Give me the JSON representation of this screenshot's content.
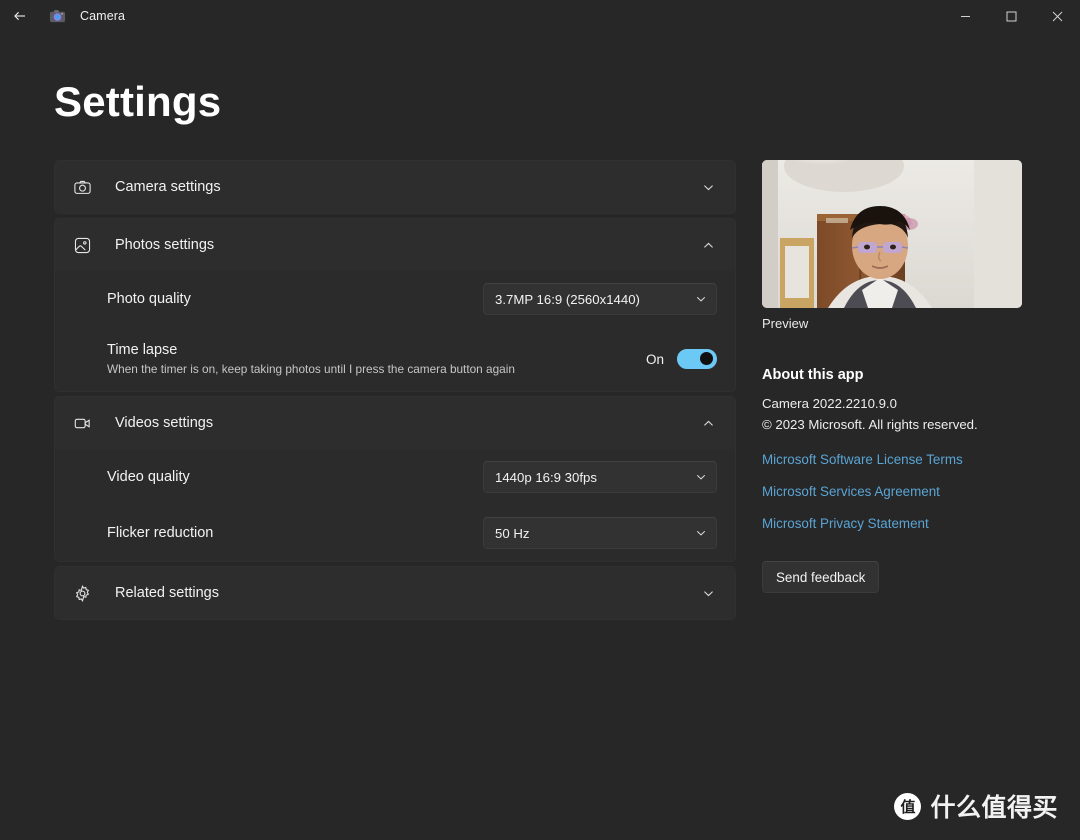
{
  "titlebar": {
    "back_label": "Back",
    "back_icon": "arrow-left-icon",
    "app_icon": "camera-app-icon",
    "app_title": "Camera",
    "minimize_label": "‒",
    "maximize_label": "☐",
    "close_label": "✕"
  },
  "page": {
    "title": "Settings"
  },
  "sections": [
    {
      "key": "camera",
      "icon": "camera-icon",
      "label": "Camera settings",
      "expanded": false,
      "chevron": "chevron-down-icon"
    },
    {
      "key": "photos",
      "icon": "photo-icon",
      "label": "Photos settings",
      "expanded": true,
      "chevron": "chevron-up-icon",
      "rows": [
        {
          "type": "combo",
          "label": "Photo quality",
          "value": "3.7MP 16:9 (2560x1440)"
        },
        {
          "type": "toggle",
          "label": "Time lapse",
          "description": "When the timer is on, keep taking photos until I press the camera button again",
          "state_label": "On",
          "checked": true
        }
      ]
    },
    {
      "key": "videos",
      "icon": "video-camera-icon",
      "label": "Videos settings",
      "expanded": true,
      "chevron": "chevron-up-icon",
      "rows": [
        {
          "type": "combo",
          "label": "Video quality",
          "value": "1440p 16:9 30fps"
        },
        {
          "type": "combo",
          "label": "Flicker reduction",
          "value": "50 Hz"
        }
      ]
    },
    {
      "key": "related",
      "icon": "gear-icon",
      "label": "Related settings",
      "expanded": false,
      "chevron": "chevron-down-icon"
    }
  ],
  "about": {
    "preview_caption": "Preview",
    "heading": "About this app",
    "app_name_version": "Camera  2022.2210.9.0",
    "copyright": "© 2023 Microsoft. All rights reserved.",
    "links": [
      "Microsoft Software License Terms",
      "Microsoft Services Agreement",
      "Microsoft Privacy Statement"
    ],
    "feedback_button": "Send feedback"
  },
  "watermark": {
    "badge": "值",
    "text": "什么值得买"
  },
  "colors": {
    "window_bg": "#272727",
    "card_bg": "#2d2d2d",
    "card_body_bg": "#2b2b2b",
    "accent_toggle": "#6cc8f4",
    "link": "#5aa4d4",
    "text_primary": "#f2f2f2",
    "text_secondary": "#c6c6c6"
  }
}
